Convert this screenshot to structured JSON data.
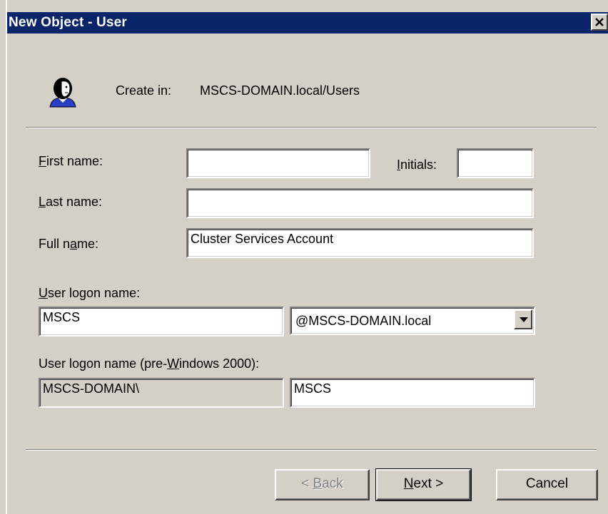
{
  "window": {
    "title": "New Object - User"
  },
  "header": {
    "create_in_label": "Create in:",
    "create_in_value": "MSCS-DOMAIN.local/Users",
    "icon": "user-icon"
  },
  "form": {
    "first_name": {
      "label_accel": "F",
      "label_rest": "irst name:",
      "value": ""
    },
    "initials": {
      "label_accel": "I",
      "label_rest": "nitials:",
      "value": ""
    },
    "last_name": {
      "label_accel": "L",
      "label_rest": "ast name:",
      "value": ""
    },
    "full_name": {
      "label_pre": "Full n",
      "label_accel": "a",
      "label_rest": "me:",
      "value": "Cluster Services Account"
    },
    "logon_name": {
      "label_accel": "U",
      "label_rest": "ser logon name:",
      "value": "MSCS",
      "domain_value": "@MSCS-DOMAIN.local"
    },
    "pre2000": {
      "label_pre": "User logon name (pre-",
      "label_accel": "W",
      "label_rest": "indows 2000):",
      "domain_value": "MSCS-DOMAIN\\",
      "value": "MSCS"
    }
  },
  "buttons": {
    "back_pre": "< ",
    "back_accel": "B",
    "back_rest": "ack",
    "next_accel": "N",
    "next_rest": "ext >",
    "cancel": "Cancel"
  }
}
